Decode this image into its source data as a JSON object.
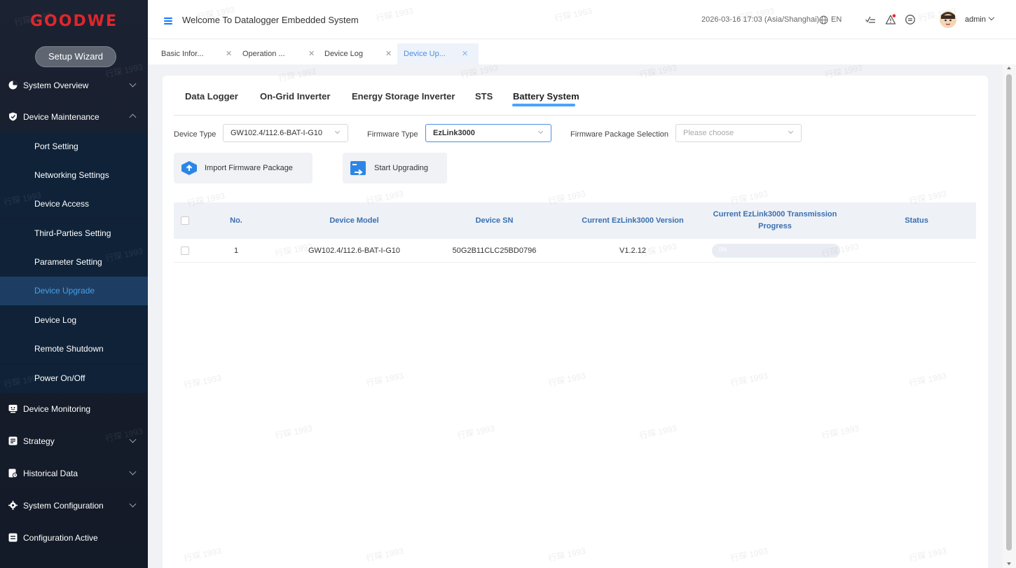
{
  "brand": {
    "logo_text": "GOODWE",
    "logo_color": "#e0262b"
  },
  "sidebar": {
    "wizard_label": "Setup Wizard",
    "items": [
      {
        "label": "System Overview",
        "icon": "pie-chart-icon"
      },
      {
        "label": "Device Maintenance",
        "icon": "shield-icon"
      },
      {
        "label": "Device Monitoring",
        "icon": "monitor-icon"
      },
      {
        "label": "Strategy",
        "icon": "strategy-icon"
      },
      {
        "label": "Historical Data",
        "icon": "history-icon"
      },
      {
        "label": "System Configuration",
        "icon": "gear-icon"
      },
      {
        "label": "Configuration Active",
        "icon": "config-icon"
      }
    ],
    "submenu": [
      "Port Setting",
      "Networking Settings",
      "Device Access",
      "Third-Parties Setting",
      "Parameter Setting",
      "Device Upgrade",
      "Device Log",
      "Remote Shutdown",
      "Power On/Off"
    ],
    "active_submenu": "Device Upgrade"
  },
  "header": {
    "welcome": "Welcome To Datalogger Embedded System",
    "datetime": "2026-03-16 17:03 (Asia/Shanghai)",
    "language": "EN",
    "user": "admin"
  },
  "tabs": [
    {
      "label": "Basic Infor..."
    },
    {
      "label": "Operation ..."
    },
    {
      "label": "Device Log"
    },
    {
      "label": "Device Up...",
      "active": true
    }
  ],
  "subtabs": [
    "Data Logger",
    "On-Grid Inverter",
    "Energy Storage Inverter",
    "STS",
    "Battery System"
  ],
  "active_subtab": "Battery System",
  "filters": {
    "device_type_label": "Device Type",
    "device_type_value": "GW102.4/112.6-BAT-I-G10",
    "firmware_type_label": "Firmware Type",
    "firmware_type_value": "EzLink3000",
    "package_label": "Firmware Package Selection",
    "package_placeholder": "Please choose"
  },
  "actions": {
    "import_label": "Import Firmware Package",
    "upgrade_label": "Start Upgrading"
  },
  "table": {
    "columns": [
      "No.",
      "Device Model",
      "Device SN",
      "Current EzLink3000 Version",
      "Current EzLink3000 Transmission Progress",
      "Status"
    ],
    "rows": [
      {
        "no": "1",
        "model": "GW102.4/112.6-BAT-I-G10",
        "sn": "50G2B11CLC25BD0796",
        "version": "V1.2.12",
        "progress": 0,
        "progress_text": "0%",
        "status": ""
      }
    ]
  },
  "watermark_text": "行琛 1993",
  "colors": {
    "accent": "#4a90e2",
    "sidebar_active_bg": "#1d3e62",
    "header_text": "#3a6fb0"
  }
}
